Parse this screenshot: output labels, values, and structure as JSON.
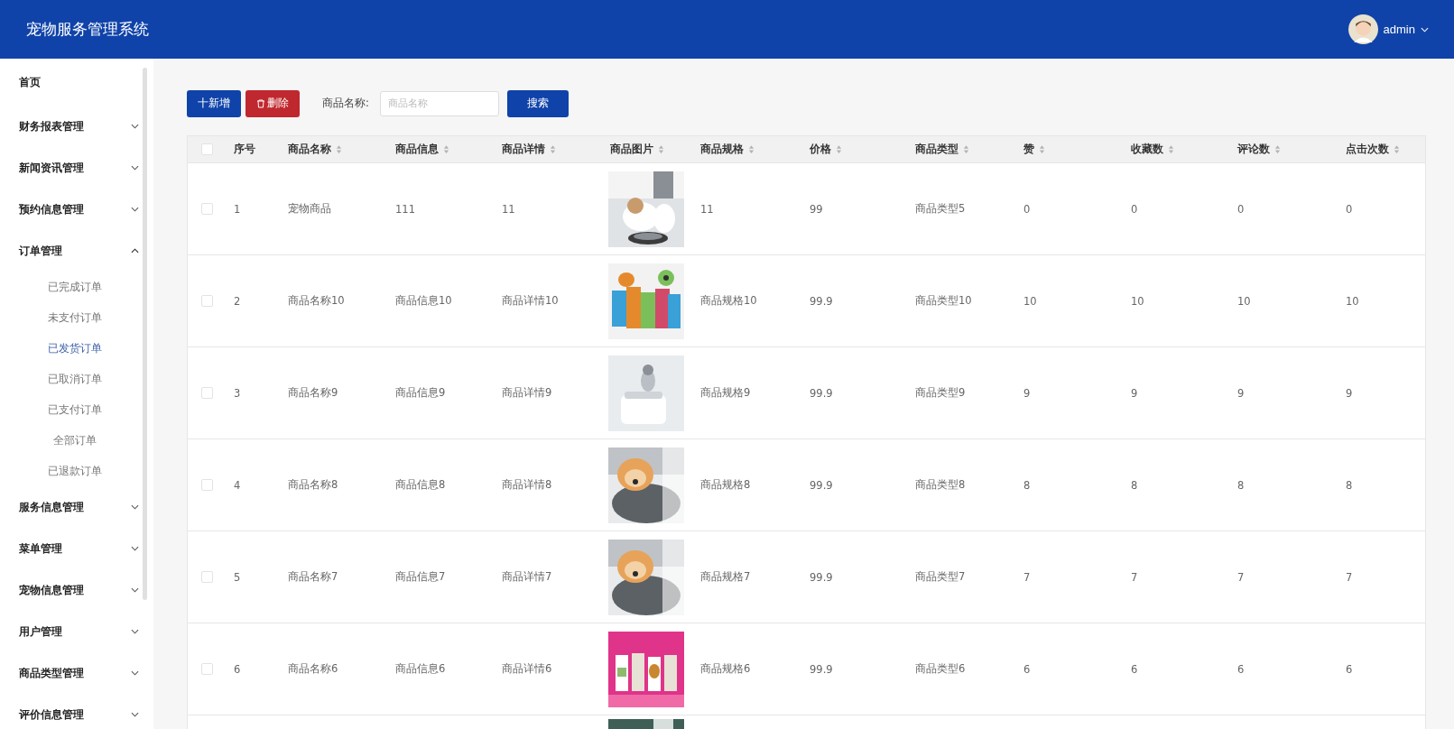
{
  "header": {
    "title": "宠物服务管理系统",
    "user": "admin"
  },
  "sidebar": {
    "items": [
      {
        "label": "首页",
        "expandable": false
      },
      {
        "label": "财务报表管理",
        "expandable": true,
        "expanded": false
      },
      {
        "label": "新闻资讯管理",
        "expandable": true,
        "expanded": false
      },
      {
        "label": "预约信息管理",
        "expandable": true,
        "expanded": false
      },
      {
        "label": "订单管理",
        "expandable": true,
        "expanded": true,
        "children": [
          {
            "label": "已完成订单",
            "selected": false
          },
          {
            "label": "未支付订单",
            "selected": false
          },
          {
            "label": "已发货订单",
            "selected": true
          },
          {
            "label": "已取消订单",
            "selected": false
          },
          {
            "label": "已支付订单",
            "selected": false
          },
          {
            "label": "全部订单",
            "selected": false
          },
          {
            "label": "已退款订单",
            "selected": false
          }
        ]
      },
      {
        "label": "服务信息管理",
        "expandable": true,
        "expanded": false
      },
      {
        "label": "菜单管理",
        "expandable": true,
        "expanded": false
      },
      {
        "label": "宠物信息管理",
        "expandable": true,
        "expanded": false
      },
      {
        "label": "用户管理",
        "expandable": true,
        "expanded": false
      },
      {
        "label": "商品类型管理",
        "expandable": true,
        "expanded": false
      },
      {
        "label": "评价信息管理",
        "expandable": true,
        "expanded": false
      }
    ]
  },
  "toolbar": {
    "add_button": "十新增",
    "delete_button": "删除",
    "search_label": "商品名称:",
    "search_placeholder": "商品名称",
    "search_button": "搜索"
  },
  "table": {
    "all_checked": false,
    "columns": [
      {
        "label": "序号",
        "sortable": false
      },
      {
        "label": "商品名称",
        "sortable": true
      },
      {
        "label": "商品信息",
        "sortable": true
      },
      {
        "label": "商品详情",
        "sortable": true
      },
      {
        "label": "商品图片",
        "sortable": true
      },
      {
        "label": "商品规格",
        "sortable": true
      },
      {
        "label": "价格",
        "sortable": true
      },
      {
        "label": "商品类型",
        "sortable": true
      },
      {
        "label": "赞",
        "sortable": true
      },
      {
        "label": "收藏数",
        "sortable": true
      },
      {
        "label": "评论数",
        "sortable": true
      },
      {
        "label": "点击次数",
        "sortable": true
      }
    ],
    "rows": [
      {
        "checked": false,
        "cells": [
          "1",
          "宠物商品",
          "111",
          "11",
          {
            "kind": "picture"
          },
          "11",
          "99",
          "商品类型5",
          "0",
          "0",
          "0",
          "0"
        ]
      },
      {
        "checked": false,
        "cells": [
          "2",
          "商品名称10",
          "商品信息10",
          "商品详情10",
          {
            "kind": "picture"
          },
          "商品规格10",
          "99.9",
          "商品类型10",
          "10",
          "10",
          "10",
          "10"
        ]
      },
      {
        "checked": false,
        "cells": [
          "3",
          "商品名称9",
          "商品信息9",
          "商品详情9",
          {
            "kind": "picture"
          },
          "商品规格9",
          "99.9",
          "商品类型9",
          "9",
          "9",
          "9",
          "9"
        ]
      },
      {
        "checked": false,
        "cells": [
          "4",
          "商品名称8",
          "商品信息8",
          "商品详情8",
          {
            "kind": "picture"
          },
          "商品规格8",
          "99.9",
          "商品类型8",
          "8",
          "8",
          "8",
          "8"
        ]
      },
      {
        "checked": false,
        "cells": [
          "5",
          "商品名称7",
          "商品信息7",
          "商品详情7",
          {
            "kind": "picture"
          },
          "商品规格7",
          "99.9",
          "商品类型7",
          "7",
          "7",
          "7",
          "7"
        ]
      },
      {
        "checked": false,
        "cells": [
          "6",
          "商品名称6",
          "商品信息6",
          "商品详情6",
          {
            "kind": "picture"
          },
          "商品规格6",
          "99.9",
          "商品类型6",
          "6",
          "6",
          "6",
          "6"
        ]
      }
    ],
    "partial_row": {
      "cells": [
        null,
        null,
        null,
        null,
        {
          "kind": "picture"
        }
      ]
    }
  }
}
